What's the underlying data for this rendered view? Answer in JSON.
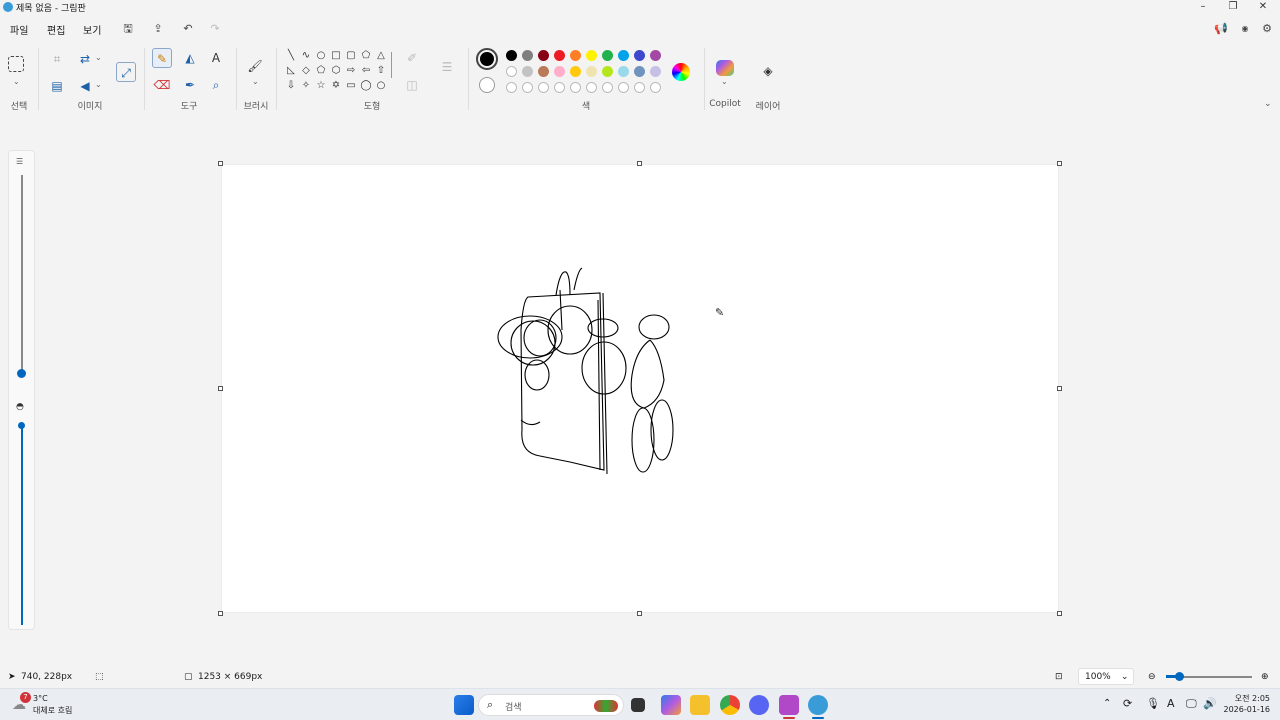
{
  "window": {
    "title": "제목 없음 - 그림판"
  },
  "menu": {
    "file": "파일",
    "edit": "편집",
    "view": "보기"
  },
  "ribbon": {
    "groups": {
      "select": "선택",
      "image": "이미지",
      "tools": "도구",
      "brush": "브러시",
      "shapes": "도형",
      "color": "색",
      "copilot": "Copilot",
      "layers": "레이어"
    }
  },
  "colors": {
    "accent": "#0067c0",
    "palette_row1": [
      "#000000",
      "#7f7f7f",
      "#880015",
      "#ed1c24",
      "#ff7f27",
      "#fff200",
      "#22b14c",
      "#00a2e8",
      "#3f48cc",
      "#a349a4"
    ],
    "palette_row2": [
      "",
      "#c3c3c3",
      "#b97a57",
      "#ffaec9",
      "#ffc90e",
      "#efe4b0",
      "#b5e61d",
      "#99d9ea",
      "#7092be",
      "#c8bfe7"
    ]
  },
  "status": {
    "cursor": "740, 228px",
    "canvas_size": "1253 × 669px",
    "zoom": "100%"
  },
  "taskbar": {
    "weather_temp": "3°C",
    "weather_desc": "대체로 흐림",
    "weather_badge": "7",
    "search_placeholder": "검색",
    "time": "오전 2:05",
    "date": "2026-01-16"
  }
}
